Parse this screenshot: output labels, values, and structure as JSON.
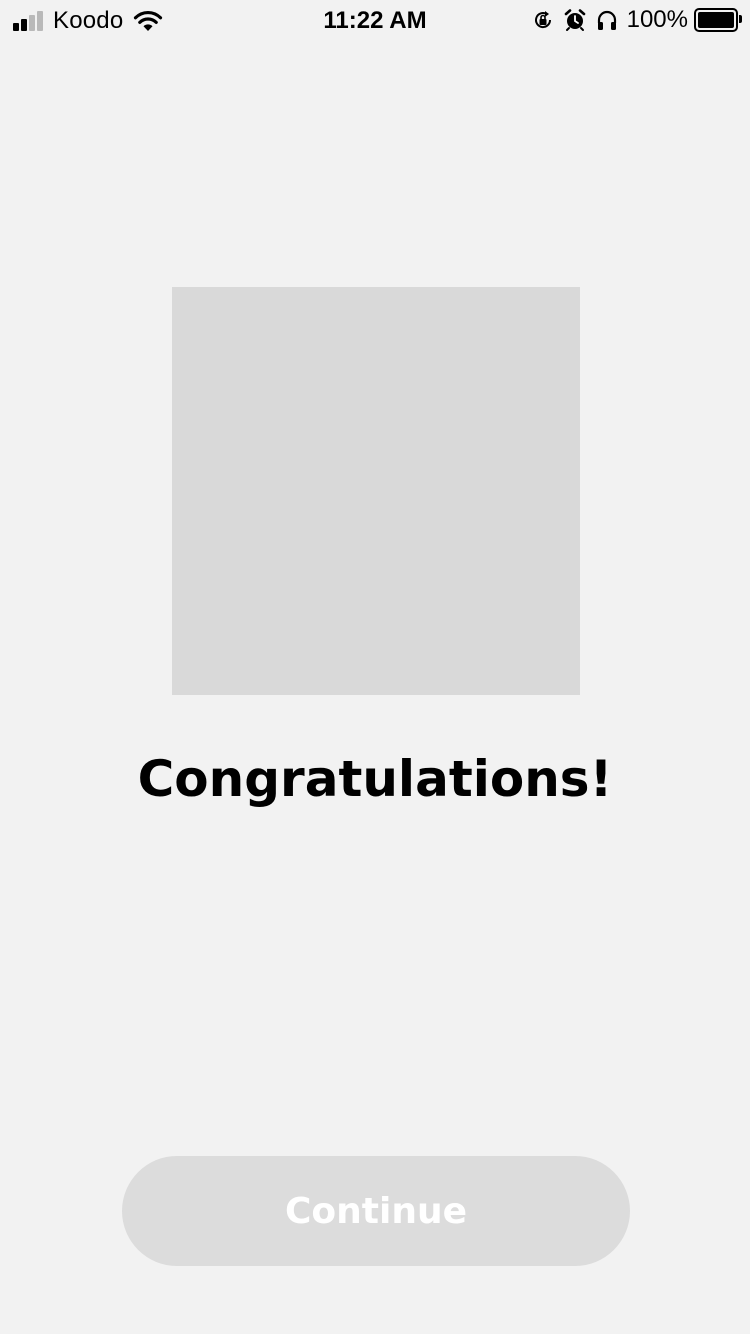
{
  "status_bar": {
    "carrier": "Koodo",
    "time": "11:22 AM",
    "battery": "100%",
    "signal_bars_active": 2,
    "signal_bars_total": 4,
    "icons": [
      "signal-icon",
      "wifi-icon",
      "orientation-lock-icon",
      "alarm-icon",
      "headphones-icon",
      "battery-icon"
    ]
  },
  "main": {
    "title": "Congratulations!"
  },
  "footer": {
    "continue_label": "Continue"
  },
  "colors": {
    "background": "#f2f2f2",
    "placeholder": "#d9d9d9",
    "button_disabled": "#dcdcdc",
    "button_text": "#ffffff"
  }
}
